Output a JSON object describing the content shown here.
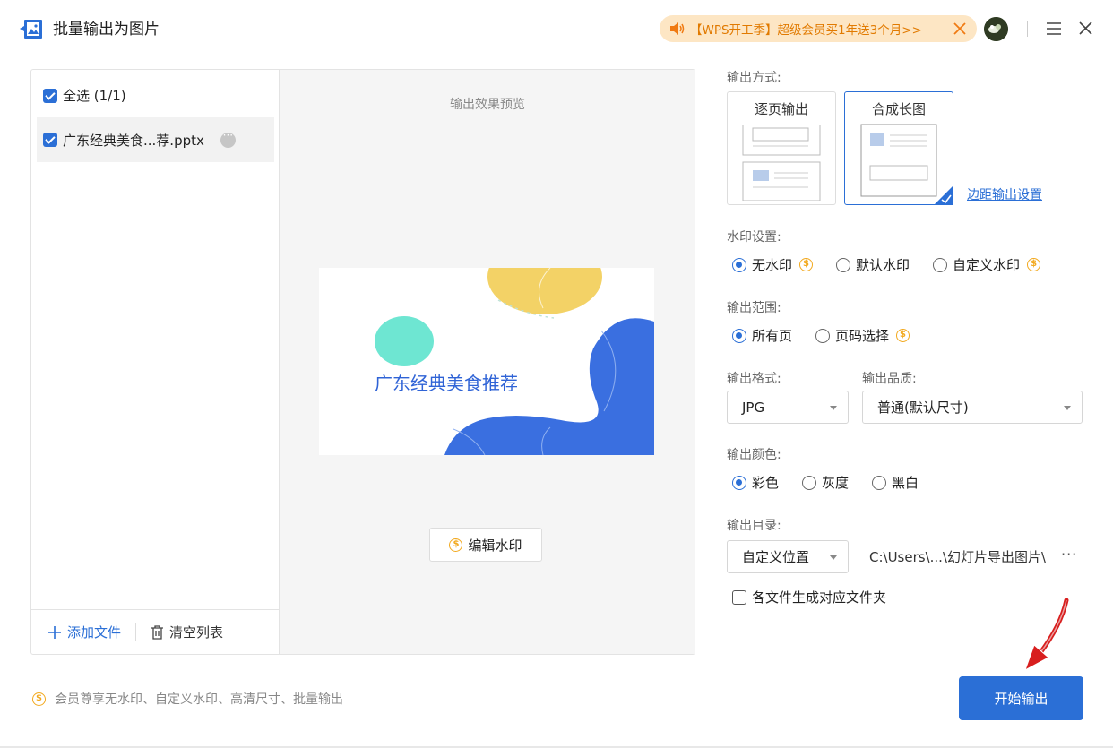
{
  "titlebar": {
    "title": "批量输出为图片",
    "promo_text": "【WPS开工季】超级会员买1年送3个月>>"
  },
  "file_list": {
    "select_all_label": "全选 (1/1)",
    "items": [
      {
        "name": "广东经典美食...荐.pptx",
        "checked": true
      }
    ],
    "add_file_label": "添加文件",
    "clear_list_label": "清空列表"
  },
  "preview": {
    "title": "输出效果预览",
    "slide_title": "广东经典美食推荐",
    "edit_watermark_label": "编辑水印"
  },
  "settings": {
    "output_mode": {
      "label": "输出方式:",
      "options": [
        "逐页输出",
        "合成长图"
      ],
      "selected": "合成长图",
      "margin_link": "边距输出设置"
    },
    "watermark": {
      "label": "水印设置:",
      "options": [
        "无水印",
        "默认水印",
        "自定义水印"
      ],
      "selected": "无水印"
    },
    "range": {
      "label": "输出范围:",
      "options": [
        "所有页",
        "页码选择"
      ],
      "selected": "所有页"
    },
    "format": {
      "label": "输出格式:",
      "value": "JPG"
    },
    "quality": {
      "label": "输出品质:",
      "value": "普通(默认尺寸)"
    },
    "color": {
      "label": "输出颜色:",
      "options": [
        "彩色",
        "灰度",
        "黑白"
      ],
      "selected": "彩色"
    },
    "directory": {
      "label": "输出目录:",
      "location_value": "自定义位置",
      "path": "C:\\Users\\...\\幻灯片导出图片\\",
      "more": "···",
      "per_file_folder_label": "各文件生成对应文件夹"
    }
  },
  "footer": {
    "note": "会员尊享无水印、自定义水印、高清尺寸、批量输出",
    "start_button": "开始输出"
  },
  "colors": {
    "accent": "#2b6fd6",
    "promo_bg": "#fde6c4",
    "promo_text": "#e17a00",
    "coin": "#f2a91e"
  }
}
